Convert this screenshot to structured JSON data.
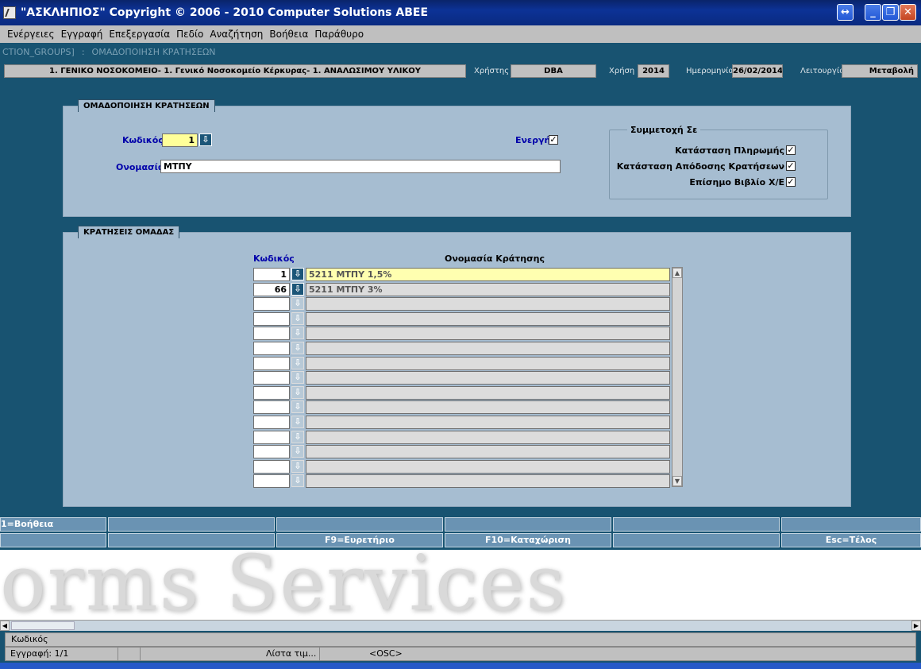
{
  "window": {
    "title": "\"ΑΣΚΛΗΠΙΟΣ\" Copyright © 2006 - 2010 Computer Solutions ABEE"
  },
  "menu": [
    "Ενέργειες",
    "Εγγραφή",
    "Επεξεργασία",
    "Πεδίο",
    "Αναζήτηση",
    "Βοήθεια",
    "Παράθυρο"
  ],
  "form_title": {
    "module": "CTION_GROUPS]",
    "separator": ":",
    "name": "ΟΜΑΔΟΠΟΙΗΣΗ ΚΡΑΤΗΣΕΩΝ"
  },
  "infobar": {
    "organization": "1. ΓΕΝΙΚΟ ΝΟΣΟΚΟΜΕΙΟ- 1. Γενικό Νοσοκομείο Κέρκυρας- 1. ΑΝΑΛΩΣΙΜΟΥ ΥΛΙΚΟΥ",
    "user_label": "Χρήστης",
    "user": "DBA",
    "year_label": "Χρήση",
    "year": "2014",
    "date_label": "Ημερομηνία",
    "date": "26/02/2014",
    "mode_label": "Λειτουργία",
    "mode": "Μεταβολή"
  },
  "header_panel": {
    "title": "ΟΜΑΔΟΠΟΙΗΣΗ ΚΡΑΤΗΣΕΩΝ",
    "code_label": "Κωδικός",
    "code_value": "1",
    "name_label": "Ονομασία",
    "name_value": "ΜΤΠΥ",
    "active_label": "Ενεργή",
    "active_checked": true,
    "participation": {
      "title": "Συμμετοχή Σε",
      "options": [
        {
          "label": "Κατάσταση Πληρωμής",
          "checked": true
        },
        {
          "label": "Κατάσταση Απόδοσης Κρατήσεων",
          "checked": true
        },
        {
          "label": "Επίσημο Βιβλίο Χ/Ε",
          "checked": true
        }
      ]
    }
  },
  "detail_panel": {
    "title": "ΚΡΑΤΗΣΕΙΣ ΟΜΑΔΑΣ",
    "col_code": "Κωδικός",
    "col_name": "Ονομασία Κράτησης",
    "rows": [
      {
        "code": "1",
        "name": "5211 ΜΤΠΥ 1,5%"
      },
      {
        "code": "66",
        "name": "5211 ΜΤΠΥ 3%"
      },
      {
        "code": "",
        "name": ""
      },
      {
        "code": "",
        "name": ""
      },
      {
        "code": "",
        "name": ""
      },
      {
        "code": "",
        "name": ""
      },
      {
        "code": "",
        "name": ""
      },
      {
        "code": "",
        "name": ""
      },
      {
        "code": "",
        "name": ""
      },
      {
        "code": "",
        "name": ""
      },
      {
        "code": "",
        "name": ""
      },
      {
        "code": "",
        "name": ""
      },
      {
        "code": "",
        "name": ""
      },
      {
        "code": "",
        "name": ""
      },
      {
        "code": "",
        "name": ""
      }
    ]
  },
  "function_keys": {
    "row1": [
      "1=Βοήθεια",
      "",
      "",
      "",
      "",
      ""
    ],
    "row2": [
      "",
      "",
      "F9=Ευρετήριο",
      "F10=Καταχώριση",
      "",
      "Esc=Τέλος"
    ]
  },
  "watermark": "orms Services",
  "status": {
    "hint": "Κωδικός",
    "record": "Εγγραφή: 1/1",
    "lov": "Λίστα τιμ...",
    "osc": "<OSC>"
  },
  "colors": {
    "background": "#185371",
    "panel": "#a6bdd1",
    "titlebar": "#0c3296",
    "label_blue": "#0000aa",
    "field_yellow": "#ffff99"
  }
}
